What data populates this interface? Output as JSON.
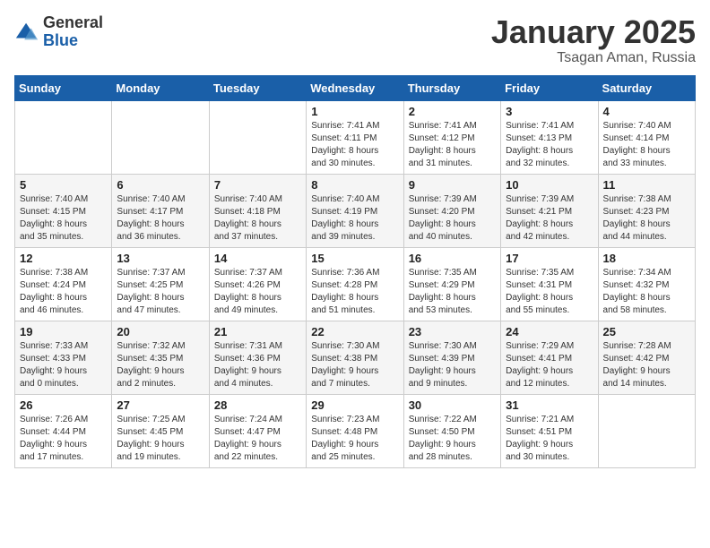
{
  "header": {
    "logo_general": "General",
    "logo_blue": "Blue",
    "month": "January 2025",
    "location": "Tsagan Aman, Russia"
  },
  "weekdays": [
    "Sunday",
    "Monday",
    "Tuesday",
    "Wednesday",
    "Thursday",
    "Friday",
    "Saturday"
  ],
  "weeks": [
    [
      {
        "day": "",
        "info": ""
      },
      {
        "day": "",
        "info": ""
      },
      {
        "day": "",
        "info": ""
      },
      {
        "day": "1",
        "info": "Sunrise: 7:41 AM\nSunset: 4:11 PM\nDaylight: 8 hours\nand 30 minutes."
      },
      {
        "day": "2",
        "info": "Sunrise: 7:41 AM\nSunset: 4:12 PM\nDaylight: 8 hours\nand 31 minutes."
      },
      {
        "day": "3",
        "info": "Sunrise: 7:41 AM\nSunset: 4:13 PM\nDaylight: 8 hours\nand 32 minutes."
      },
      {
        "day": "4",
        "info": "Sunrise: 7:40 AM\nSunset: 4:14 PM\nDaylight: 8 hours\nand 33 minutes."
      }
    ],
    [
      {
        "day": "5",
        "info": "Sunrise: 7:40 AM\nSunset: 4:15 PM\nDaylight: 8 hours\nand 35 minutes."
      },
      {
        "day": "6",
        "info": "Sunrise: 7:40 AM\nSunset: 4:17 PM\nDaylight: 8 hours\nand 36 minutes."
      },
      {
        "day": "7",
        "info": "Sunrise: 7:40 AM\nSunset: 4:18 PM\nDaylight: 8 hours\nand 37 minutes."
      },
      {
        "day": "8",
        "info": "Sunrise: 7:40 AM\nSunset: 4:19 PM\nDaylight: 8 hours\nand 39 minutes."
      },
      {
        "day": "9",
        "info": "Sunrise: 7:39 AM\nSunset: 4:20 PM\nDaylight: 8 hours\nand 40 minutes."
      },
      {
        "day": "10",
        "info": "Sunrise: 7:39 AM\nSunset: 4:21 PM\nDaylight: 8 hours\nand 42 minutes."
      },
      {
        "day": "11",
        "info": "Sunrise: 7:38 AM\nSunset: 4:23 PM\nDaylight: 8 hours\nand 44 minutes."
      }
    ],
    [
      {
        "day": "12",
        "info": "Sunrise: 7:38 AM\nSunset: 4:24 PM\nDaylight: 8 hours\nand 46 minutes."
      },
      {
        "day": "13",
        "info": "Sunrise: 7:37 AM\nSunset: 4:25 PM\nDaylight: 8 hours\nand 47 minutes."
      },
      {
        "day": "14",
        "info": "Sunrise: 7:37 AM\nSunset: 4:26 PM\nDaylight: 8 hours\nand 49 minutes."
      },
      {
        "day": "15",
        "info": "Sunrise: 7:36 AM\nSunset: 4:28 PM\nDaylight: 8 hours\nand 51 minutes."
      },
      {
        "day": "16",
        "info": "Sunrise: 7:35 AM\nSunset: 4:29 PM\nDaylight: 8 hours\nand 53 minutes."
      },
      {
        "day": "17",
        "info": "Sunrise: 7:35 AM\nSunset: 4:31 PM\nDaylight: 8 hours\nand 55 minutes."
      },
      {
        "day": "18",
        "info": "Sunrise: 7:34 AM\nSunset: 4:32 PM\nDaylight: 8 hours\nand 58 minutes."
      }
    ],
    [
      {
        "day": "19",
        "info": "Sunrise: 7:33 AM\nSunset: 4:33 PM\nDaylight: 9 hours\nand 0 minutes."
      },
      {
        "day": "20",
        "info": "Sunrise: 7:32 AM\nSunset: 4:35 PM\nDaylight: 9 hours\nand 2 minutes."
      },
      {
        "day": "21",
        "info": "Sunrise: 7:31 AM\nSunset: 4:36 PM\nDaylight: 9 hours\nand 4 minutes."
      },
      {
        "day": "22",
        "info": "Sunrise: 7:30 AM\nSunset: 4:38 PM\nDaylight: 9 hours\nand 7 minutes."
      },
      {
        "day": "23",
        "info": "Sunrise: 7:30 AM\nSunset: 4:39 PM\nDaylight: 9 hours\nand 9 minutes."
      },
      {
        "day": "24",
        "info": "Sunrise: 7:29 AM\nSunset: 4:41 PM\nDaylight: 9 hours\nand 12 minutes."
      },
      {
        "day": "25",
        "info": "Sunrise: 7:28 AM\nSunset: 4:42 PM\nDaylight: 9 hours\nand 14 minutes."
      }
    ],
    [
      {
        "day": "26",
        "info": "Sunrise: 7:26 AM\nSunset: 4:44 PM\nDaylight: 9 hours\nand 17 minutes."
      },
      {
        "day": "27",
        "info": "Sunrise: 7:25 AM\nSunset: 4:45 PM\nDaylight: 9 hours\nand 19 minutes."
      },
      {
        "day": "28",
        "info": "Sunrise: 7:24 AM\nSunset: 4:47 PM\nDaylight: 9 hours\nand 22 minutes."
      },
      {
        "day": "29",
        "info": "Sunrise: 7:23 AM\nSunset: 4:48 PM\nDaylight: 9 hours\nand 25 minutes."
      },
      {
        "day": "30",
        "info": "Sunrise: 7:22 AM\nSunset: 4:50 PM\nDaylight: 9 hours\nand 28 minutes."
      },
      {
        "day": "31",
        "info": "Sunrise: 7:21 AM\nSunset: 4:51 PM\nDaylight: 9 hours\nand 30 minutes."
      },
      {
        "day": "",
        "info": ""
      }
    ]
  ]
}
